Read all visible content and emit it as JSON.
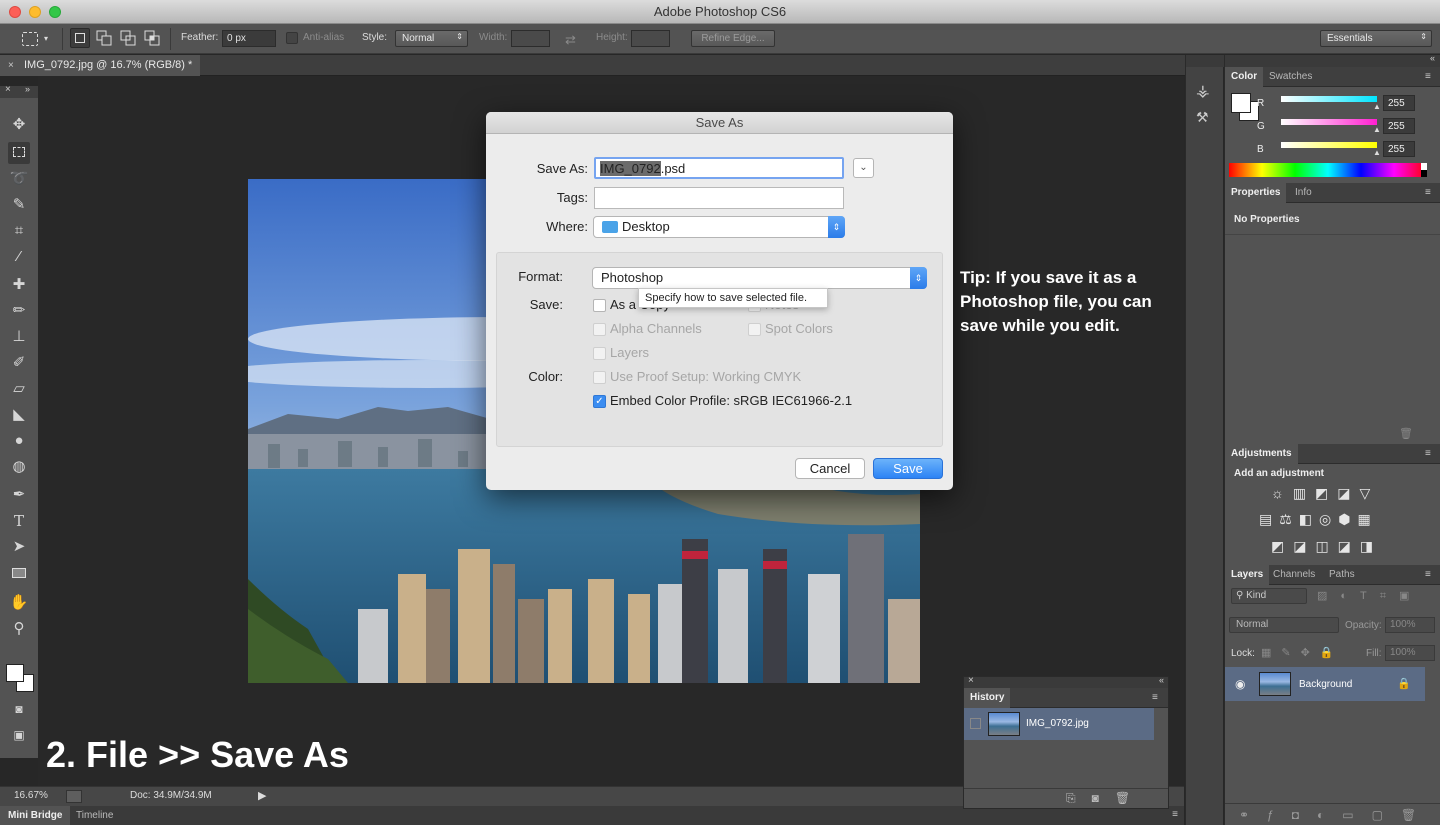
{
  "window": {
    "title": "Adobe Photoshop CS6"
  },
  "options_bar": {
    "feather_label": "Feather:",
    "feather_value": "0 px",
    "antialias_label": "Anti-alias",
    "style_label": "Style:",
    "style_value": "Normal",
    "width_label": "Width:",
    "height_label": "Height:",
    "refine_edge_label": "Refine Edge...",
    "workspace_value": "Essentials"
  },
  "document": {
    "tab_title": "IMG_0792.jpg @ 16.7% (RGB/8) *"
  },
  "status_bar": {
    "zoom": "16.67%",
    "doc_info": "Doc: 34.9M/34.9M"
  },
  "bottom_tabs": [
    "Mini Bridge",
    "Timeline"
  ],
  "color_panel": {
    "tabs": [
      "Color",
      "Swatches"
    ],
    "channels": [
      {
        "label": "R",
        "value": "255"
      },
      {
        "label": "G",
        "value": "255"
      },
      {
        "label": "B",
        "value": "255"
      }
    ],
    "colors": {
      "r": "#00e5ff",
      "g": "#ff1fd0",
      "b": "#ffff00"
    }
  },
  "properties_panel": {
    "tabs": [
      "Properties",
      "Info"
    ],
    "message": "No Properties"
  },
  "adjustments_panel": {
    "tab": "Adjustments",
    "heading": "Add an adjustment"
  },
  "layers_panel": {
    "tabs": [
      "Layers",
      "Channels",
      "Paths"
    ],
    "filter_kind": "Kind",
    "blend_mode": "Normal",
    "opacity_label": "Opacity:",
    "opacity_value": "100%",
    "lock_label": "Lock:",
    "fill_label": "Fill:",
    "fill_value": "100%",
    "layers": [
      {
        "name": "Background"
      }
    ]
  },
  "history_panel": {
    "tab": "History",
    "items": [
      {
        "name": "IMG_0792.jpg"
      }
    ]
  },
  "save_dialog": {
    "title": "Save As",
    "save_as_label": "Save As:",
    "filename_selected": "IMG_0792",
    "filename_ext": ".psd",
    "tags_label": "Tags:",
    "where_label": "Where:",
    "where_value": "Desktop",
    "format_label": "Format:",
    "format_value": "Photoshop",
    "tooltip": "Specify how to save selected file.",
    "save_label": "Save:",
    "options": {
      "as_a_copy": "As a Copy",
      "notes": "Notes",
      "alpha_channels": "Alpha Channels",
      "spot_colors": "Spot Colors",
      "layers": "Layers"
    },
    "color_label": "Color:",
    "use_proof_setup": "Use Proof Setup:  Working CMYK",
    "embed_color_profile": "Embed Color Profile:  sRGB IEC61966-2.1",
    "cancel_label": "Cancel",
    "save_button_label": "Save"
  },
  "annotations": {
    "tip": "Tip: If you save it as a Photoshop file, you can save while you edit.",
    "caption": "2. File >> Save As"
  }
}
